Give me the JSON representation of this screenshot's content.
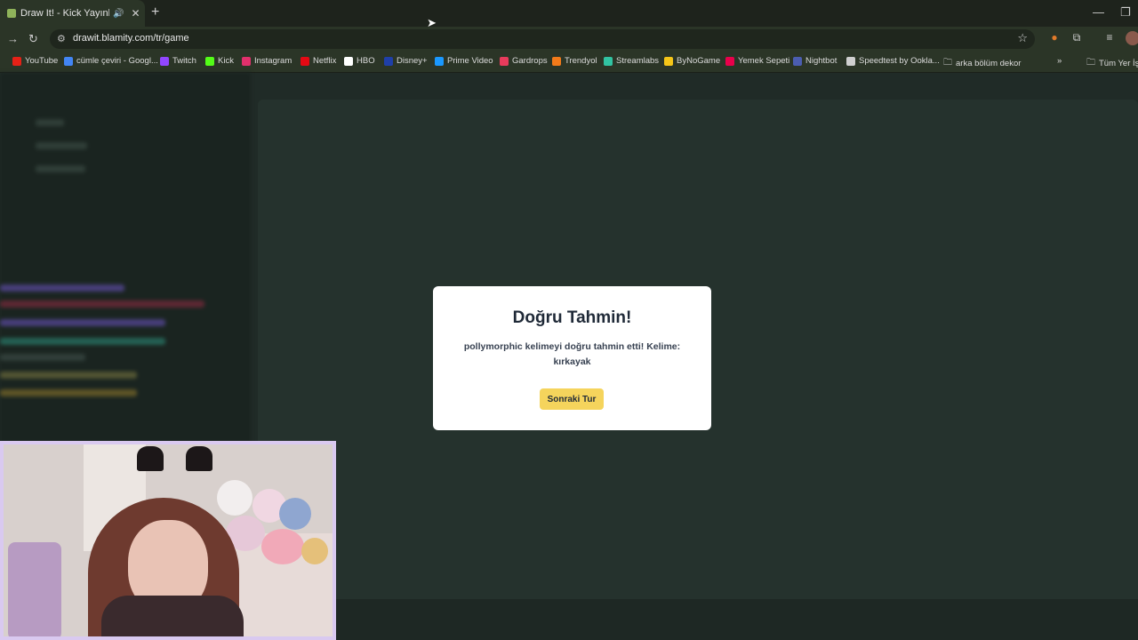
{
  "browser": {
    "tab": {
      "title": "Draw It! - Kick Yayınları İçin"
    },
    "url": "drawit.blamity.com/tr/game",
    "bookmarks": [
      {
        "label": "YouTube",
        "color": "#e62117"
      },
      {
        "label": "cümle çeviri - Googl...",
        "color": "#4285f4"
      },
      {
        "label": "Twitch",
        "color": "#9146ff"
      },
      {
        "label": "Kick",
        "color": "#53fc18"
      },
      {
        "label": "Instagram",
        "color": "#e1306c"
      },
      {
        "label": "Netflix",
        "color": "#e50914"
      },
      {
        "label": "HBO",
        "color": "#ffffff"
      },
      {
        "label": "Disney+",
        "color": "#1f3fa8"
      },
      {
        "label": "Prime Video",
        "color": "#1a98ff"
      },
      {
        "label": "Gardrops",
        "color": "#e83b5c"
      },
      {
        "label": "Trendyol",
        "color": "#f27a1a"
      },
      {
        "label": "Streamlabs",
        "color": "#31c3a2"
      },
      {
        "label": "ByNoGame",
        "color": "#f5c518"
      },
      {
        "label": "Yemek Sepeti",
        "color": "#ea004b"
      },
      {
        "label": "Nightbot",
        "color": "#4b5db0"
      },
      {
        "label": "Speedtest by Ookla...",
        "color": "#cfcfcf"
      },
      {
        "label": "arka bölüm dekor",
        "color": "folder"
      }
    ],
    "bookmarks_right": "Tüm Yer İş"
  },
  "modal": {
    "title": "Doğru Tahmin!",
    "message": "pollymorphic kelimeyi doğru tahmin etti! Kelime: kırkayak",
    "button": "Sonraki Tur"
  }
}
